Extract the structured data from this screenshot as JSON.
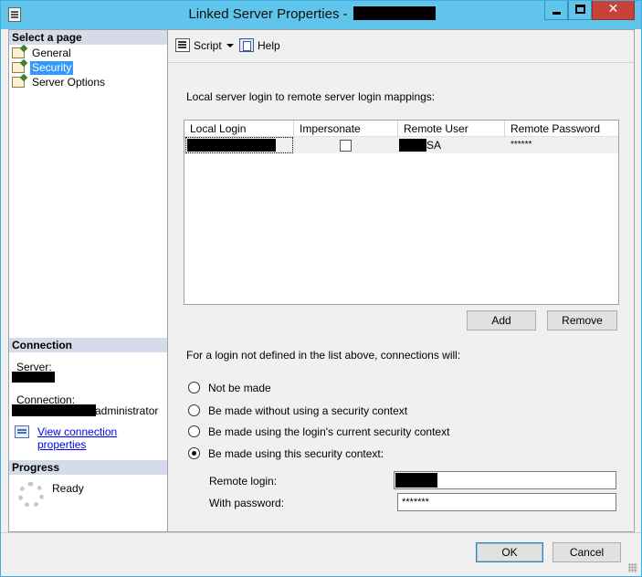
{
  "window": {
    "title": "Linked Server Properties -",
    "close_glyph": "✕"
  },
  "left": {
    "select_page_header": "Select a page",
    "pages": [
      {
        "label": "General",
        "icon": "page-icon"
      },
      {
        "label": "Security",
        "icon": "page-icon",
        "selected": true
      },
      {
        "label": "Server Options",
        "icon": "page-icon"
      }
    ],
    "connection_header": "Connection",
    "server_label": "Server:",
    "connection_label": "Connection:",
    "connection_user_suffix": "administrator",
    "view_connection_link": "View connection properties",
    "progress_header": "Progress",
    "progress_status": "Ready"
  },
  "toolbar": {
    "script_label": "Script",
    "help_label": "Help"
  },
  "security": {
    "mappings_caption": "Local server login to remote server login mappings:",
    "columns": [
      "Local Login",
      "Impersonate",
      "Remote User",
      "Remote Password"
    ],
    "rows": [
      {
        "local_login": "",
        "impersonate": false,
        "remote_user_suffix": "SA",
        "remote_password": "******"
      }
    ],
    "add_label": "Add",
    "remove_label": "Remove",
    "not_defined_caption": "For a login not defined in the list above, connections will:",
    "options": [
      {
        "label": "Not be made",
        "checked": false
      },
      {
        "label": "Be made without using a security context",
        "checked": false
      },
      {
        "label": "Be made using the login's current security context",
        "checked": false
      },
      {
        "label": "Be made using this security context:",
        "checked": true
      }
    ],
    "remote_login_label": "Remote login:",
    "remote_login_value": "",
    "password_label": "With password:",
    "password_value": "*******"
  },
  "footer": {
    "ok_label": "OK",
    "cancel_label": "Cancel"
  }
}
